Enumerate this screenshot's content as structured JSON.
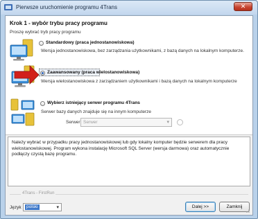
{
  "window": {
    "title": "Pierwsze uruchomienie programu 4Trans",
    "close_label": "✕"
  },
  "step": {
    "title": "Krok 1 - wybór trybu pracy programu",
    "subtitle": "Proszę wybrać tryb pracy programu"
  },
  "options": [
    {
      "label": "Standardowy (praca jednostanowiskowa)",
      "description": "Wersja jednostanowiskowa, bez zarządzania użytkownikami, z bazą danych na lokalnym komputerze.",
      "selected": false
    },
    {
      "label": "Zaawansowany (praca wielostanowiskowa)",
      "description": "Wersja wielostanowiskowa z zarządzaniem użytkownikami i bazą danych na lokalnym komputerze",
      "selected": true
    },
    {
      "label": "Wybierz istniejący serwer programu 4Trans",
      "description": "Serwer bazy danych znajduje się na innym komputerze",
      "selected": false
    }
  ],
  "server": {
    "label": "Serwer:",
    "placeholder": "Serwer"
  },
  "info": {
    "text": "Należy wybrać w przypadku pracy jednostanowiskowej lub gdy lokalny komputer będzie serwerem dla pracy wielostanowiskowej. Program wykona instalację Microsoft SQL Server (wersja darmowa) oraz automatycznie podłączy czystą bazę programu."
  },
  "footer": {
    "caption": "4Trans - FirstRun",
    "language_label": "Język",
    "language_value": "polski",
    "next_label": "Dalej >>",
    "close_label": "Zamknij"
  },
  "colors": {
    "accent": "#2a62b8",
    "arrow": "#d21f1a",
    "monitor": "#3a8fd8",
    "tower": "#e7c23a"
  },
  "icons": [
    "computer-icon",
    "computer-with-arrow-icon",
    "computer-network-icon",
    "refresh-icon",
    "app-icon"
  ]
}
